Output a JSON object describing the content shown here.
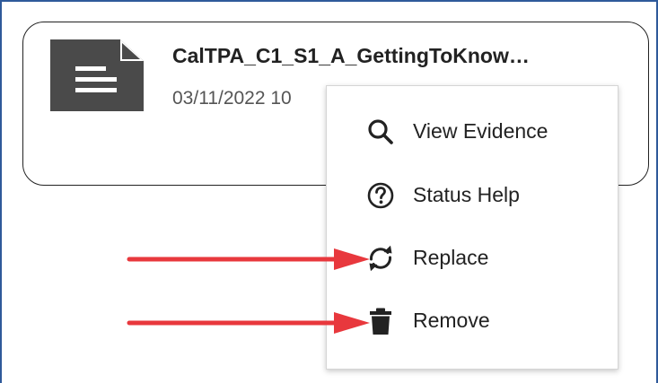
{
  "file_card": {
    "icon": "document-icon",
    "name": "CalTPA_C1_S1_A_GettingToKnow…",
    "date": "03/11/2022 10"
  },
  "context_menu": {
    "items": [
      {
        "icon": "search-icon",
        "label": "View Evidence"
      },
      {
        "icon": "question-circle-icon",
        "label": "Status Help"
      },
      {
        "icon": "replace-icon",
        "label": "Replace"
      },
      {
        "icon": "trash-icon",
        "label": "Remove"
      }
    ]
  },
  "colors": {
    "frame_border": "#2f5a9a",
    "annotation_arrow": "#e8383d",
    "file_icon": "#4a4a4a",
    "menu_icon": "#222222"
  }
}
